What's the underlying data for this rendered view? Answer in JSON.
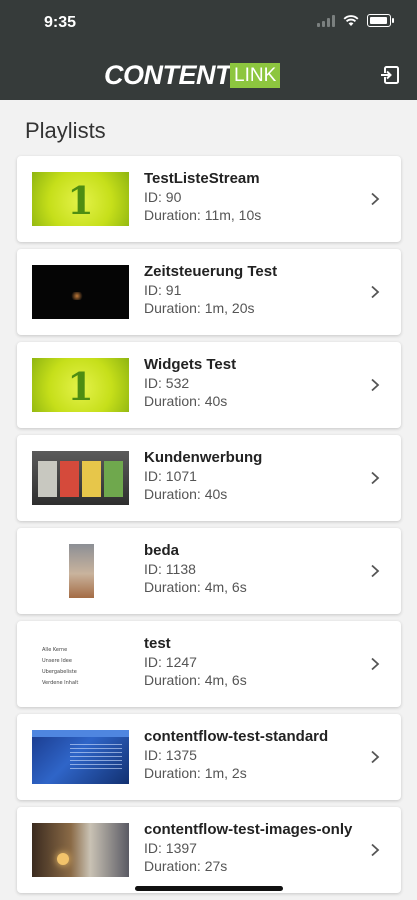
{
  "status": {
    "time": "9:35"
  },
  "header": {
    "logo_content": "CONTENT",
    "logo_link": "LINK"
  },
  "page": {
    "title": "Playlists"
  },
  "playlists": [
    {
      "name": "TestListeStream",
      "id": "ID: 90",
      "duration": "Duration: 11m, 10s",
      "thumb": "one",
      "digit": "1"
    },
    {
      "name": "Zeitsteuerung Test",
      "id": "ID: 91",
      "duration": "Duration: 1m, 20s",
      "thumb": "dark"
    },
    {
      "name": "Widgets Test",
      "id": "ID: 532",
      "duration": "Duration: 40s",
      "thumb": "one",
      "digit": "1"
    },
    {
      "name": "Kundenwerbung",
      "id": "ID: 1071",
      "duration": "Duration: 40s",
      "thumb": "store"
    },
    {
      "name": "beda",
      "id": "ID: 1138",
      "duration": "Duration: 4m, 6s",
      "thumb": "phone"
    },
    {
      "name": "test",
      "id": "ID: 1247",
      "duration": "Duration: 4m, 6s",
      "thumb": "text",
      "thumb_lines": [
        "Alle Kerne",
        "Unsere Idee",
        "Ubergabeliste",
        "Verdene Inhalt"
      ]
    },
    {
      "name": "contentflow-test-standard",
      "id": "ID: 1375",
      "duration": "Duration: 1m, 2s",
      "thumb": "blue"
    },
    {
      "name": "contentflow-test-images-only",
      "id": "ID: 1397",
      "duration": "Duration: 27s",
      "thumb": "room"
    }
  ],
  "icons": {
    "logout": "logout-icon",
    "chevron": "chevron-right-icon",
    "wifi": "wifi-icon",
    "battery": "battery-icon"
  },
  "colors": {
    "header_bg": "#363b3a",
    "accent": "#8dc63f",
    "background": "#f2f2f2"
  }
}
